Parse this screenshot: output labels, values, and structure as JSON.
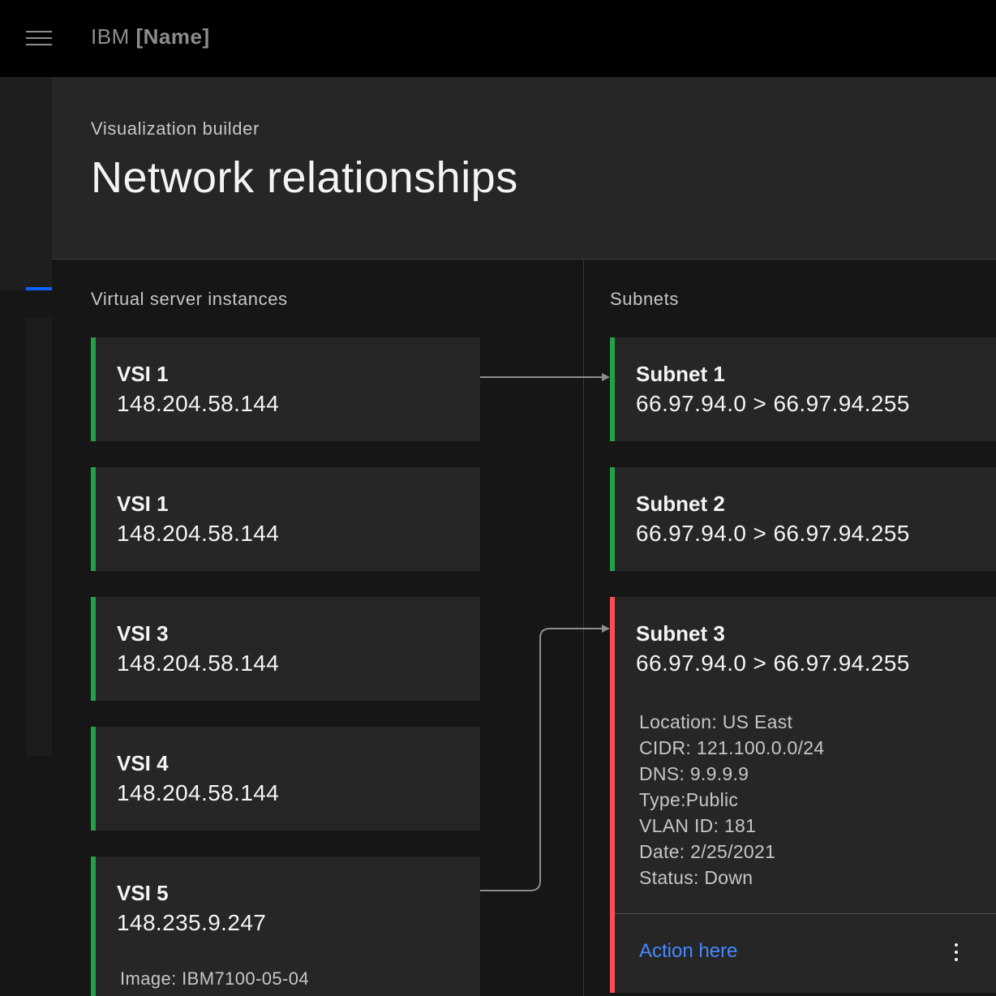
{
  "header": {
    "brand_prefix": "IBM",
    "brand_name": "[Name]"
  },
  "modal": {
    "label": "Visualization builder",
    "title": "Network relationships"
  },
  "columns": {
    "left_title": "Virtual server instances",
    "right_title": "Subnets"
  },
  "vsis": [
    {
      "name": "VSI 1",
      "ip": "148.204.58.144",
      "status_color": "#24a148"
    },
    {
      "name": "VSI 1",
      "ip": "148.204.58.144",
      "status_color": "#24a148"
    },
    {
      "name": "VSI 3",
      "ip": "148.204.58.144",
      "status_color": "#24a148"
    },
    {
      "name": "VSI 4",
      "ip": "148.204.58.144",
      "status_color": "#24a148"
    },
    {
      "name": "VSI 5",
      "ip": "148.235.9.247",
      "image": "Image: IBM7100-05-04",
      "status_color": "#24a148"
    }
  ],
  "subnets": [
    {
      "name": "Subnet 1",
      "range": "66.97.94.0 > 66.97.94.255",
      "status_color": "#24a148"
    },
    {
      "name": "Subnet 2",
      "range": "66.97.94.0 > 66.97.94.255",
      "status_color": "#24a148"
    },
    {
      "name": "Subnet 3",
      "range": "66.97.94.0 > 66.97.94.255",
      "status_color": "#fa4d56",
      "details": {
        "location": "Location: US East",
        "cidr": "CIDR: 121.100.0.0/24",
        "dns": "DNS: 9.9.9.9",
        "type": "Type:Public",
        "vlan": "VLAN ID: 181",
        "date": "Date: 2/25/2021",
        "status": "Status: Down"
      },
      "action_label": "Action here"
    }
  ],
  "connections": [
    {
      "from": "VSI 1",
      "to": "Subnet 1"
    },
    {
      "from": "VSI 5",
      "to": "Subnet 3"
    }
  ],
  "icons": {
    "menu": "hamburger-menu-icon",
    "overflow": "overflow-menu-vertical-icon"
  }
}
